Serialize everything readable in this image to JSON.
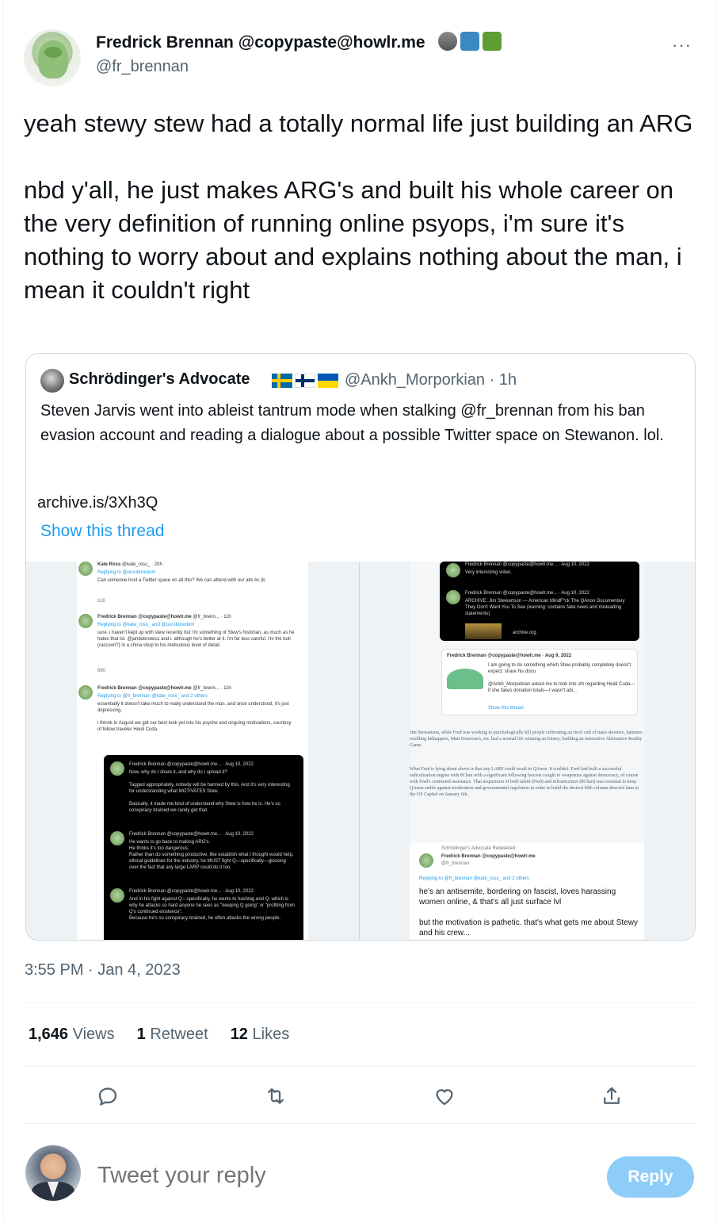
{
  "author": {
    "name": "Fredrick Brennan @copypaste@howlr.me",
    "handle": "@fr_brennan",
    "emoji_icons": [
      "raccoon-icon",
      "input-symbols-icon",
      "green-book-icon"
    ]
  },
  "more_label": "···",
  "tweet": {
    "text": "yeah stewy stew had a totally normal life just building an ARG\n\nnbd y'all, he just makes ARG's and built his whole career on the very definition of running online psyops, i'm sure it's nothing to worry about and explains nothing about the man, i mean it couldn't right",
    "timestamp": "3:55 PM · Jan 4, 2023"
  },
  "quote": {
    "name": "Schrödinger's Advocate",
    "flag_icons": [
      "sweden-flag-icon",
      "finland-flag-icon",
      "ukraine-flag-icon"
    ],
    "handle_time": "@Ankh_Morporkian · 1h",
    "text": "Steven Jarvis went into ableist tantrum mode when stalking @fr_brennan from his ban evasion account and reading a dialogue about a possible Twitter space on Stewanon. lol.",
    "link": "archive.is/3Xh3Q",
    "show_thread": "Show this thread",
    "media": {
      "left": {
        "t1_name": "Kate Ross",
        "t1_meta": "@kate_ross_ · 20h",
        "t1_reply": "Replying to @ouroboredom",
        "t1_text": "Can someone host a Twitter space on all this? We can attend with our alts bc jfc",
        "t1_stats": "118",
        "t2_name": "Fredrick Brennan @copypaste@howlr.me",
        "t2_meta": "@fr_brenn... · 11h",
        "t2_reply": "Replying to @kate_ross_ and @ouroboredom",
        "t2_text": "sure. i haven't kept up with stew recently but i'm something of Stew's historian, as much as he hates that lol. @janbobrowicz and i. although he's better at it. i'm far less careful. i'm the bull (raccoon?) in a china shop to his meticulous level of detail.",
        "t2_stats": "690",
        "t3_name": "Fredrick Brennan @copypaste@howlr.me",
        "t3_meta": "@fr_brenn... · 11h",
        "t3_reply": "Replying to @fr_brennan @kate_ross_ and 2 others",
        "t3_text": "essentially it doesn't take much to really understand the man. and once understood, it's just depressing.\n\ni thinnk in August we got our best look yet into his psyche and ongoing motivations, courtesy of fellow traveler Heidi Cuda.",
        "d1_head": "Fredrick Brennan @copypaste@howlr.me... · Aug 10, 2022",
        "d1_text": "Now, why do I share it, and why do I upload it?\n\nTagged appropriately, nobody will be harmed by this. And it's very interesting for understanding what MOTIVATES Stew.\n\nBasically, it made me kind of understand why Stew is how he is. He's so conspiracy brained we rarely get that.",
        "d2_head": "Fredrick Brennan @copypaste@howlr.me... · Aug 10, 2022",
        "d2_text": "He wants to go back to making ARG's.\nHe thinks it's too dangerous.\nRather than do something productive, like establish what I thought would help, ethical guidelines for the industry, he MUST fight Q—specifically—glossing over the fact that any large LARP could do it too.",
        "d3_head": "Fredrick Brennan @copypaste@howlr.me... · Aug 10, 2022",
        "d3_text": "And in his fight against Q—specifically, he wants to hashtag end Q, which is why he attacks so hard anyone he sees as \"keeping Q going\" or \"profiting from Q's continued existence\".\nBecause he's so conspiracy-brained, he often attacks the wrong people."
      },
      "right": {
        "r1_head": "Fredrick Brennan @copypaste@howlr.me... · Aug 10, 2022",
        "r1_text": "Very interesting video.",
        "r2_head": "Fredrick Brennan @copypaste@howlr.me... · Aug 10, 2022",
        "r2_text": "ARCHIVE: Jim Stewartson — American MindF*ck The QAnon Documentary They Don't Want You To See (warning: contains fake news and misleading statements)",
        "r2_link": "archive.org",
        "r3_head": "Fredrick Brennan @copypaste@howlr.me · Aug 9, 2022",
        "r3_text": "I am going to do something which Stew probably completely doesn't expect: share his docu\n\n@Ankh_Morporkian asked me to look into sth regarding Heidi Cuda—if she fakes donation totals—I wasn't abl...",
        "r3_thread": "Show this thread",
        "body1": "Jim Stewartson, while Fred was working to psychologically kill people cultivating an Incel cult of mass shooters, hammer-wielding kidnappers, Matt Donovan's, etc. had a normal life winning an Emmy, building an interactive Alternative Reality Game.",
        "body2": "What Fred is lying about above is that any LARP could result in QAnon. It couldn't. Fred had built a successful radicalization engine with 8Chan with a significant following fascists sought to weaponize against democracy, of course with Fred's continued assistance. That acquisition of both talent (Fred) and infrastructure (8Chan) was essential to keep QAnon stable against moderation and governmental regulation in order to build the desired fifth column directed later at the US Capitol on January 6th.",
        "rt_label": "Schrödinger's Advocate Retweeted",
        "rt_name": "Fredrick Brennan @copypaste@howlr.me",
        "rt_handle": "@fr_brennan",
        "rt_reply": "Replying to @fr_brennan @kate_ross_ and 2 others",
        "rt_text": "he's an antisemite, bordering on fascist, loves harassing women online, & that's all just surface lvl\n\nbut the motivation is pathetic. that's what gets me about Stewy and his crew..."
      }
    }
  },
  "stats": {
    "views_count": "1,646",
    "views_label": "Views",
    "retweets_count": "1",
    "retweets_label": "Retweet",
    "likes_count": "12",
    "likes_label": "Likes"
  },
  "actions": [
    "reply-icon",
    "retweet-icon",
    "like-icon",
    "share-icon"
  ],
  "reply_box": {
    "placeholder": "Tweet your reply",
    "button_label": "Reply"
  },
  "colors": {
    "accent": "#1d9bf0",
    "secondary_text": "#536471",
    "reply_button_disabled": "#8ecdf8",
    "border": "#cfd9de"
  }
}
